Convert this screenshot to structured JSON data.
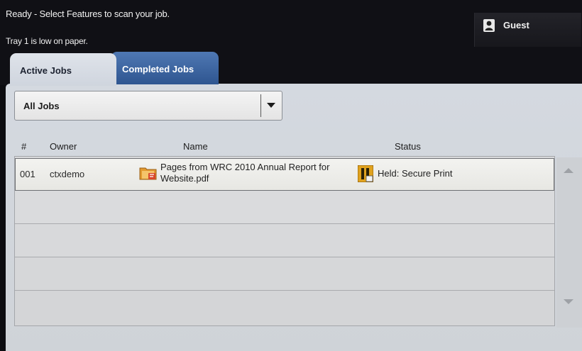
{
  "status": {
    "line1": "Ready - Select Features to scan your job.",
    "line2": "Tray 1 is low on paper."
  },
  "user": {
    "label": "Guest",
    "icon": "user-icon"
  },
  "tabs": [
    {
      "label": "Active Jobs",
      "active": true
    },
    {
      "label": "Completed Jobs",
      "active": false
    }
  ],
  "filter": {
    "selected": "All Jobs",
    "icon": "chevron-down-icon"
  },
  "table": {
    "columns": [
      "#",
      "Owner",
      "Name",
      "Status"
    ],
    "rows": [
      {
        "num": "001",
        "owner": "ctxdemo",
        "name": "Pages from WRC 2010 Annual Report for Website.pdf",
        "status": "Held: Secure Print",
        "doc_icon": "document-icon",
        "status_icon": "held-icon"
      }
    ]
  },
  "colors": {
    "tab_inactive": "#2e5590",
    "panel": "#d4d9e0",
    "held_icon": "#e0a21e",
    "doc_icon": "#e6a23a"
  }
}
